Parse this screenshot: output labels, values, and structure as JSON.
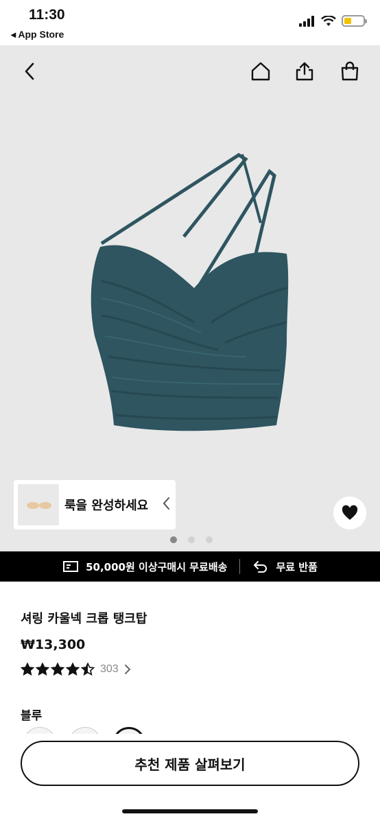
{
  "status": {
    "time": "11:30",
    "back_app": "◂ App Store"
  },
  "icons": {
    "back": "chevron-left-icon",
    "home": "home-icon",
    "share": "share-icon",
    "cart": "shopping-bag-icon",
    "wishlist": "heart-icon"
  },
  "gallery": {
    "look_text": "룩을 완성하세요",
    "page_count": 3,
    "active_page": 1
  },
  "shipping": {
    "free_shipping": "50,000원 이상구매시 무료배송",
    "free_return": "무료 반품"
  },
  "product": {
    "name": "셔링 카울넥 크롭 탱크탑",
    "price": "₩13,300",
    "rating": 4.5,
    "review_count": "303",
    "color_label": "블루"
  },
  "cta": {
    "recommend_label": "추천 제품 살펴보기"
  },
  "colors": {
    "product": "#2e5560",
    "battery": "#f2c200"
  }
}
